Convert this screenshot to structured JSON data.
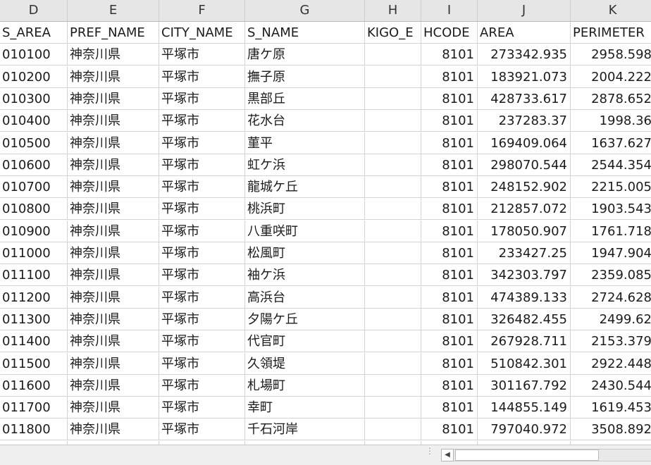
{
  "columns": {
    "D": "D",
    "E": "E",
    "F": "F",
    "G": "G",
    "H": "H",
    "I": "I",
    "J": "J",
    "K": "K"
  },
  "header_row": {
    "S_AREA": "S_AREA",
    "PREF_NAME": "PREF_NAME",
    "CITY_NAME": "CITY_NAME",
    "S_NAME": "S_NAME",
    "KIGO_E": "KIGO_E",
    "HCODE": "HCODE",
    "AREA": "AREA",
    "PERIMETER": "PERIMETER"
  },
  "rows": [
    {
      "s_area": "010100",
      "pref": "神奈川県",
      "city": "平塚市",
      "s_name": "唐ケ原",
      "kigo": "",
      "hcode": "8101",
      "area": "273342.935",
      "perimeter": "2958.598"
    },
    {
      "s_area": "010200",
      "pref": "神奈川県",
      "city": "平塚市",
      "s_name": "撫子原",
      "kigo": "",
      "hcode": "8101",
      "area": "183921.073",
      "perimeter": "2004.222"
    },
    {
      "s_area": "010300",
      "pref": "神奈川県",
      "city": "平塚市",
      "s_name": "黒部丘",
      "kigo": "",
      "hcode": "8101",
      "area": "428733.617",
      "perimeter": "2878.652"
    },
    {
      "s_area": "010400",
      "pref": "神奈川県",
      "city": "平塚市",
      "s_name": "花水台",
      "kigo": "",
      "hcode": "8101",
      "area": "237283.37",
      "perimeter": "1998.36"
    },
    {
      "s_area": "010500",
      "pref": "神奈川県",
      "city": "平塚市",
      "s_name": "菫平",
      "kigo": "",
      "hcode": "8101",
      "area": "169409.064",
      "perimeter": "1637.627"
    },
    {
      "s_area": "010600",
      "pref": "神奈川県",
      "city": "平塚市",
      "s_name": "虹ケ浜",
      "kigo": "",
      "hcode": "8101",
      "area": "298070.544",
      "perimeter": "2544.354"
    },
    {
      "s_area": "010700",
      "pref": "神奈川県",
      "city": "平塚市",
      "s_name": "龍城ケ丘",
      "kigo": "",
      "hcode": "8101",
      "area": "248152.902",
      "perimeter": "2215.005"
    },
    {
      "s_area": "010800",
      "pref": "神奈川県",
      "city": "平塚市",
      "s_name": "桃浜町",
      "kigo": "",
      "hcode": "8101",
      "area": "212857.072",
      "perimeter": "1903.543"
    },
    {
      "s_area": "010900",
      "pref": "神奈川県",
      "city": "平塚市",
      "s_name": "八重咲町",
      "kigo": "",
      "hcode": "8101",
      "area": "178050.907",
      "perimeter": "1761.718"
    },
    {
      "s_area": "011000",
      "pref": "神奈川県",
      "city": "平塚市",
      "s_name": "松風町",
      "kigo": "",
      "hcode": "8101",
      "area": "233427.25",
      "perimeter": "1947.904"
    },
    {
      "s_area": "011100",
      "pref": "神奈川県",
      "city": "平塚市",
      "s_name": "袖ケ浜",
      "kigo": "",
      "hcode": "8101",
      "area": "342303.797",
      "perimeter": "2359.085"
    },
    {
      "s_area": "011200",
      "pref": "神奈川県",
      "city": "平塚市",
      "s_name": "高浜台",
      "kigo": "",
      "hcode": "8101",
      "area": "474389.133",
      "perimeter": "2724.628"
    },
    {
      "s_area": "011300",
      "pref": "神奈川県",
      "city": "平塚市",
      "s_name": "夕陽ケ丘",
      "kigo": "",
      "hcode": "8101",
      "area": "326482.455",
      "perimeter": "2499.62"
    },
    {
      "s_area": "011400",
      "pref": "神奈川県",
      "city": "平塚市",
      "s_name": "代官町",
      "kigo": "",
      "hcode": "8101",
      "area": "267928.711",
      "perimeter": "2153.379"
    },
    {
      "s_area": "011500",
      "pref": "神奈川県",
      "city": "平塚市",
      "s_name": "久領堤",
      "kigo": "",
      "hcode": "8101",
      "area": "510842.301",
      "perimeter": "2922.448"
    },
    {
      "s_area": "011600",
      "pref": "神奈川県",
      "city": "平塚市",
      "s_name": "札場町",
      "kigo": "",
      "hcode": "8101",
      "area": "301167.792",
      "perimeter": "2430.544"
    },
    {
      "s_area": "011700",
      "pref": "神奈川県",
      "city": "平塚市",
      "s_name": "幸町",
      "kigo": "",
      "hcode": "8101",
      "area": "144855.149",
      "perimeter": "1619.453"
    },
    {
      "s_area": "011800",
      "pref": "神奈川県",
      "city": "平塚市",
      "s_name": "千石河岸",
      "kigo": "",
      "hcode": "8101",
      "area": "797040.972",
      "perimeter": "3508.892"
    }
  ],
  "icons": {
    "scroll_left": "scroll-left-arrow-icon",
    "split_grip": "split-grip-icon"
  }
}
